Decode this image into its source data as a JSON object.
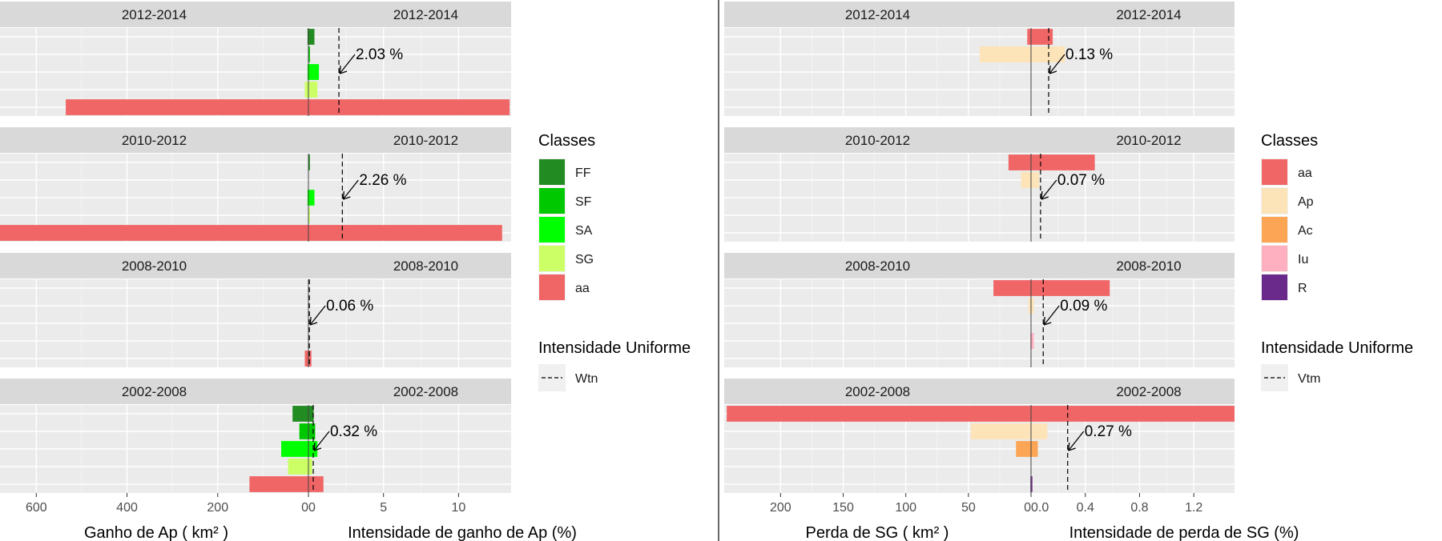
{
  "chart_data": [
    {
      "type": "bar",
      "left_xlabel": "Ganho de Ap ( km² )",
      "right_xlabel": "Intensidade de ganho de Ap (%)",
      "left_ticks": [
        600,
        400,
        200,
        0
      ],
      "right_ticks": [
        0,
        5,
        10
      ],
      "left_xlim": [
        680,
        0
      ],
      "right_xlim": [
        0,
        13.5
      ],
      "categories": [
        "FF",
        "SF",
        "SA",
        "SG",
        "aa"
      ],
      "legend": {
        "title": "Classes",
        "entries": [
          {
            "label": "FF",
            "color": "#228B22"
          },
          {
            "label": "SF",
            "color": "#00C800"
          },
          {
            "label": "SA",
            "color": "#00FF00"
          },
          {
            "label": "SG",
            "color": "#CCFF66"
          },
          {
            "label": "aa",
            "color": "#F06666"
          }
        ],
        "line_title": "Intensidade Uniforme",
        "line_label": "Wtn"
      },
      "panels": [
        {
          "period": "2012-2014",
          "uniform_label": "2.03 %",
          "uniform": 2.03,
          "area": [
            2,
            1,
            2,
            8,
            535
          ],
          "intensity": [
            0.4,
            0.1,
            0.7,
            0.6,
            13.4
          ]
        },
        {
          "period": "2010-2012",
          "uniform_label": "2.26 %",
          "uniform": 2.26,
          "area": [
            0,
            0.5,
            2,
            0.5,
            680
          ],
          "intensity": [
            0.1,
            0,
            0.4,
            0.1,
            12.9
          ]
        },
        {
          "period": "2008-2010",
          "uniform_label": "0.06 %",
          "uniform": 0.06,
          "area": [
            0,
            0,
            0,
            0,
            8
          ],
          "intensity": [
            0,
            0,
            0,
            0,
            0.2
          ]
        },
        {
          "period": "2002-2008",
          "uniform_label": "0.32 %",
          "uniform": 0.32,
          "area": [
            35,
            20,
            60,
            45,
            130
          ],
          "intensity": [
            0.35,
            0.45,
            0.6,
            0.25,
            1.0
          ]
        }
      ]
    },
    {
      "type": "bar",
      "left_xlabel": "Perda de SG ( km² )",
      "right_xlabel": "Intensidade de perda de SG (%)",
      "left_ticks": [
        200,
        150,
        100,
        50,
        0
      ],
      "right_ticks": [
        0.0,
        0.4,
        0.8,
        1.2
      ],
      "right_tick_labels": [
        "0.0",
        "0.4",
        "0.8",
        "1.2"
      ],
      "left_xlim": [
        245,
        0
      ],
      "right_xlim": [
        0,
        1.5
      ],
      "categories": [
        "aa",
        "Ap",
        "Ac",
        "Iu",
        "R"
      ],
      "legend": {
        "title": "Classes",
        "entries": [
          {
            "label": "aa",
            "color": "#F06666"
          },
          {
            "label": "Ap",
            "color": "#FDE3B8"
          },
          {
            "label": "Ac",
            "color": "#FCA555"
          },
          {
            "label": "Iu",
            "color": "#FFB0C0"
          },
          {
            "label": "R",
            "color": "#6A2A8C"
          }
        ],
        "line_title": "Intensidade Uniforme",
        "line_label": "Vtm"
      },
      "panels": [
        {
          "period": "2012-2014",
          "uniform_label": "0.13 %",
          "uniform": 0.13,
          "area": [
            3,
            41,
            0,
            0,
            0
          ],
          "intensity": [
            0.16,
            0.25,
            0,
            0,
            0
          ]
        },
        {
          "period": "2010-2012",
          "uniform_label": "0.07 %",
          "uniform": 0.07,
          "area": [
            18,
            8,
            0,
            0,
            0
          ],
          "intensity": [
            0.47,
            0.06,
            0,
            0,
            0
          ]
        },
        {
          "period": "2008-2010",
          "uniform_label": "0.09 %",
          "uniform": 0.09,
          "area": [
            30,
            2,
            0,
            0.5,
            0
          ],
          "intensity": [
            0.58,
            0.02,
            0,
            0.02,
            0
          ]
        },
        {
          "period": "2002-2008",
          "uniform_label": "0.27 %",
          "uniform": 0.27,
          "area": [
            243,
            48,
            12,
            0,
            0.5
          ],
          "intensity": [
            1.5,
            0.12,
            0.05,
            0,
            0.01
          ]
        }
      ]
    }
  ]
}
